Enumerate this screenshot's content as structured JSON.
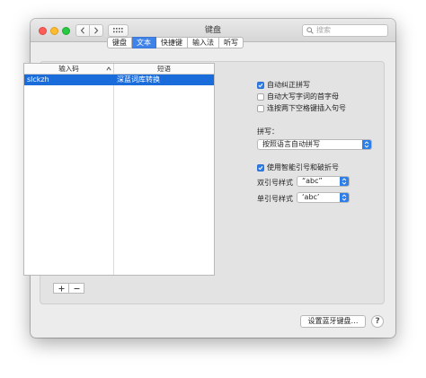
{
  "window": {
    "title": "键盘",
    "search_placeholder": "搜索"
  },
  "tabs": [
    {
      "label": "键盘",
      "active": false
    },
    {
      "label": "文本",
      "active": true
    },
    {
      "label": "快捷键",
      "active": false
    },
    {
      "label": "输入法",
      "active": false
    },
    {
      "label": "听写",
      "active": false
    }
  ],
  "table": {
    "columns": [
      "输入码",
      "短语"
    ],
    "rows": [
      {
        "input": "slckzh",
        "phrase": "深蓝词库转换",
        "selected": true
      }
    ]
  },
  "table_controls": {
    "add": "+",
    "remove": "−"
  },
  "options": {
    "autocorrect": {
      "label": "自动纠正拼写",
      "checked": true
    },
    "autocap": {
      "label": "自动大写字词的首字母",
      "checked": false
    },
    "double_space": {
      "label": "连按两下空格键插入句号",
      "checked": false
    },
    "spelling_label": "拼写：",
    "spelling_value": "按照语言自动拼写",
    "smart_quotes": {
      "label": "使用智能引号和破折号",
      "checked": true
    },
    "double_quote_label": "双引号样式",
    "double_quote_value": "“abc”",
    "single_quote_label": "单引号样式",
    "single_quote_value": "‘abc’"
  },
  "footer": {
    "bluetooth_button": "设置蓝牙键盘…",
    "help": "?"
  },
  "colors": {
    "accent": "#2f7de6",
    "selection": "#1a6cdb",
    "window_bg": "#ececec"
  }
}
